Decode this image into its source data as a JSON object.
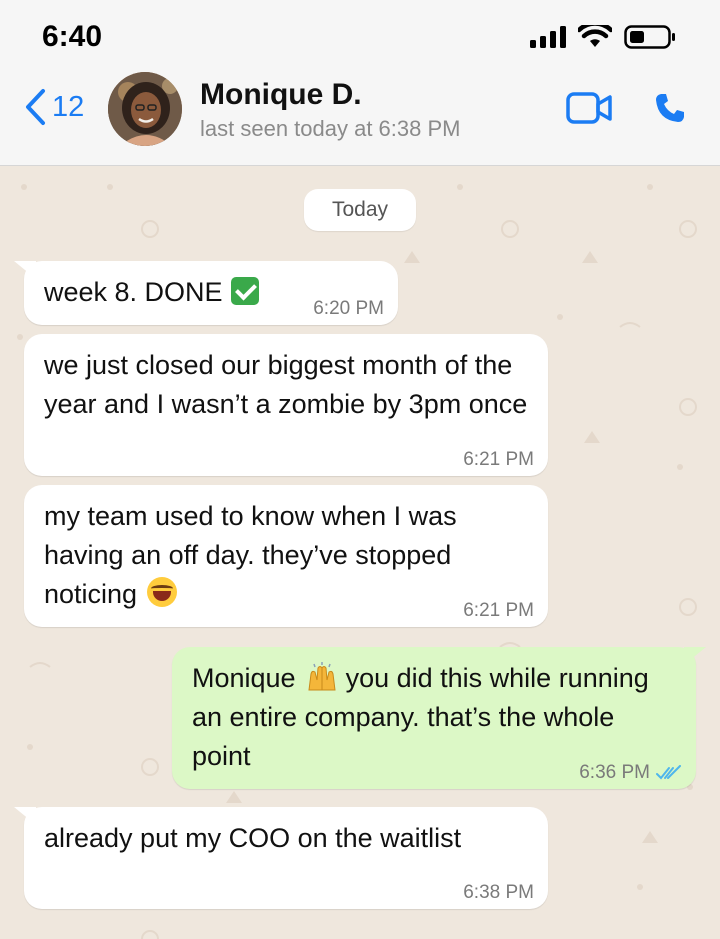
{
  "status_bar": {
    "time": "6:40"
  },
  "header": {
    "back_count": "12",
    "contact_name": "Monique D.",
    "contact_status": "last seen today at 6:38 PM"
  },
  "chat": {
    "date_label": "Today",
    "messages": [
      {
        "direction": "in",
        "text": "week 8. DONE",
        "emoji": "check-mark-emoji",
        "time": "6:20 PM"
      },
      {
        "direction": "in",
        "text": "we just closed our biggest month of the year and I wasn’t a zombie by 3pm once",
        "time": "6:21 PM"
      },
      {
        "direction": "in",
        "text": "my team used to know when I was having an off day. they’ve stopped noticing",
        "emoji": "laughing-emoji",
        "time": "6:21 PM"
      },
      {
        "direction": "out",
        "text_before": "Monique",
        "emoji": "raised-hands-emoji",
        "text_after": "you did this while running an entire company. that’s the whole point",
        "time": "6:36 PM",
        "read": true
      },
      {
        "direction": "in",
        "text": "already put my COO on the waitlist",
        "time": "6:38 PM"
      }
    ]
  },
  "colors": {
    "accent": "#1b7cf3",
    "incoming_bubble": "#ffffff",
    "outgoing_bubble": "#dcf8c6",
    "chat_background": "#efe7dd",
    "read_ticks": "#4fb6ec"
  }
}
